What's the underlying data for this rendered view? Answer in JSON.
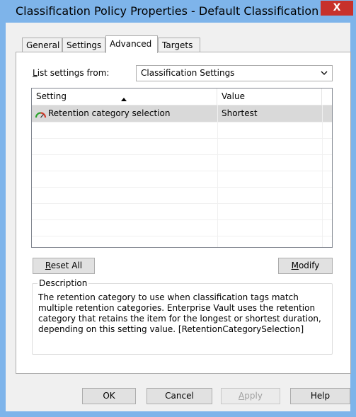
{
  "window": {
    "title": "Classification Policy Properties - Default Classification ...",
    "close_label": "X"
  },
  "tabs": [
    {
      "label": "General",
      "active": false
    },
    {
      "label": "Settings",
      "active": false
    },
    {
      "label": "Advanced",
      "active": true
    },
    {
      "label": "Targets",
      "active": false
    }
  ],
  "list_settings": {
    "label_mnemonic": "L",
    "label_rest": "ist settings from:",
    "selected": "Classification Settings"
  },
  "list": {
    "columns": [
      "Setting",
      "Value"
    ],
    "rows": [
      {
        "setting": "Retention category selection",
        "value": "Shortest",
        "icon": "gauge-icon"
      }
    ]
  },
  "buttons": {
    "reset_mnemonic": "R",
    "reset_rest": "eset All",
    "modify_mnemonic": "M",
    "modify_rest": "odify",
    "ok": "OK",
    "cancel": "Cancel",
    "apply_mnemonic": "A",
    "apply_rest": "pply",
    "help": "Help"
  },
  "description": {
    "label": "Description",
    "text": "The retention category to use when classification tags match multiple retention categories. Enterprise Vault uses the retention category that retains the item for the longest or shortest duration, depending on this setting value. [RetentionCategorySelection]"
  },
  "colors": {
    "titlebar": "#7eb4ea",
    "close": "#c7312b",
    "selected_row": "#d9d9d9"
  }
}
